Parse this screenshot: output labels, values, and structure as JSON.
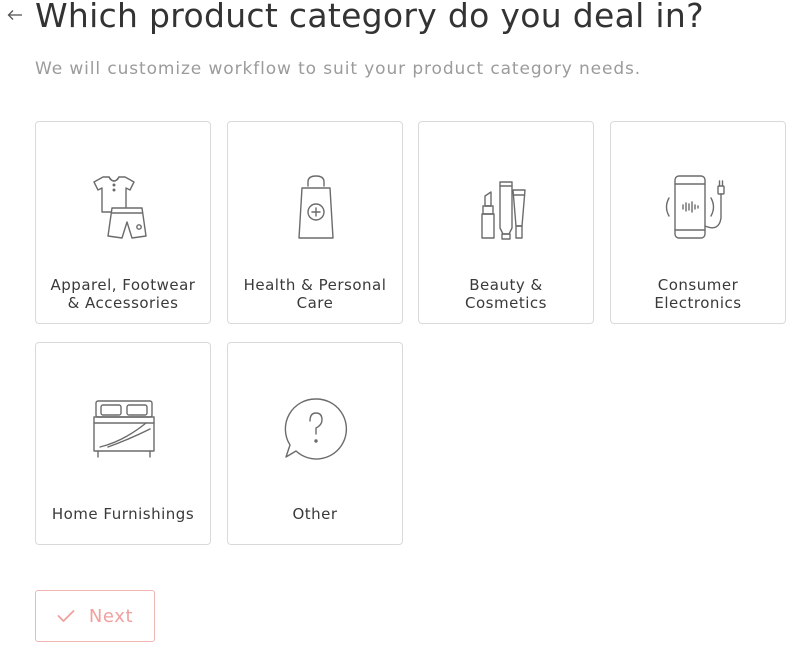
{
  "header": {
    "title": "Which product category do you deal in?",
    "subtitle": "We will customize workflow to suit your product category needs.",
    "back_icon": "arrow-left-icon"
  },
  "categories": [
    {
      "line1": "Apparel, Footwear",
      "line2": "& Accessories",
      "icon": "apparel-icon"
    },
    {
      "line1": "Health & Personal",
      "line2": "Care",
      "icon": "health-bag-icon"
    },
    {
      "line1": "Beauty &",
      "line2": "Cosmetics",
      "icon": "cosmetics-icon"
    },
    {
      "line1": "Consumer",
      "line2": "Electronics",
      "icon": "smartphone-charger-icon"
    },
    {
      "line1": "Home Furnishings",
      "line2": "",
      "icon": "bed-icon"
    },
    {
      "line1": "Other",
      "line2": "",
      "icon": "question-bubble-icon"
    }
  ],
  "actions": {
    "next_label": "Next",
    "next_icon": "checkmark-icon",
    "accent_color": "#f0a19e"
  }
}
